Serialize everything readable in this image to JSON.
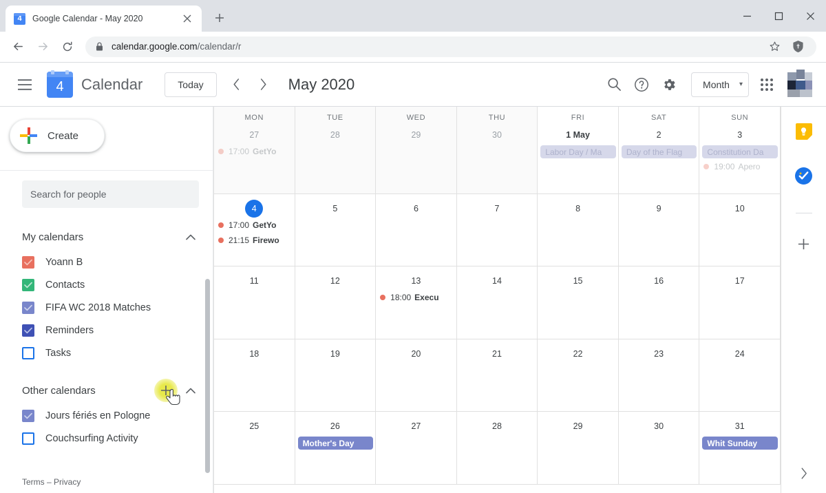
{
  "browser": {
    "tab": {
      "title": "Google Calendar - May 2020",
      "favicon_label": "4",
      "close_icon": "close-icon"
    },
    "newtab_icon": "plus-icon",
    "window_controls": {
      "minimize": "minimize-icon",
      "maximize": "maximize-icon",
      "close": "close-icon"
    },
    "nav": {
      "back": "back-arrow-icon",
      "forward": "forward-arrow-icon",
      "reload": "reload-icon"
    },
    "omnibox": {
      "lock_icon": "lock-icon",
      "url_bold": "calendar.google.com",
      "url_dim": "/calendar/r",
      "star_icon": "star-icon",
      "extension_icon": "shield-extension-icon"
    }
  },
  "app": {
    "menu_icon": "hamburger-menu-icon",
    "logo_day": "4",
    "logo_text": "Calendar",
    "today_label": "Today",
    "prev_icon": "chevron-left-icon",
    "next_icon": "chevron-right-icon",
    "month_title": "May 2020",
    "search_icon": "search-icon",
    "help_icon": "help-icon",
    "settings_icon": "gear-icon",
    "view": "Month",
    "view_caret": "chevron-down-icon",
    "apps_icon": "google-apps-grid-icon"
  },
  "sidebar": {
    "create_label": "Create",
    "search_placeholder": "Search for people",
    "search_value": "",
    "my_calendars": {
      "title": "My calendars",
      "collapse_icon": "chevron-up-icon",
      "items": [
        {
          "label": "Yoann B",
          "color": "#e8705f",
          "checked": true
        },
        {
          "label": "Contacts",
          "color": "#33b679",
          "checked": true
        },
        {
          "label": "FIFA WC 2018 Matches",
          "color": "#7986cb",
          "checked": true
        },
        {
          "label": "Reminders",
          "color": "#3f51b5",
          "checked": true
        },
        {
          "label": "Tasks",
          "color": "#1a73e8",
          "checked": false
        }
      ]
    },
    "other_calendars": {
      "title": "Other calendars",
      "add_icon": "plus-icon",
      "collapse_icon": "chevron-up-icon",
      "items": [
        {
          "label": "Jours fériés en Pologne",
          "color": "#7986cb",
          "checked": true
        },
        {
          "label": "Couchsurfing Activity",
          "color": "#1a73e8",
          "checked": false
        }
      ]
    },
    "terms": "Terms – Privacy"
  },
  "calendar": {
    "day_headers": [
      "MON",
      "TUE",
      "WED",
      "THU",
      "FRI",
      "SAT",
      "SUN"
    ],
    "weeks": [
      [
        {
          "num": "27",
          "other_month": true,
          "show_dow": true,
          "events": [
            {
              "kind": "dot",
              "time": "17:00",
              "title": "GetYo",
              "color": "#e8705f",
              "muted": true
            }
          ]
        },
        {
          "num": "28",
          "other_month": true,
          "show_dow": true,
          "events": []
        },
        {
          "num": "29",
          "other_month": true,
          "show_dow": true,
          "events": []
        },
        {
          "num": "30",
          "other_month": true,
          "show_dow": true,
          "events": []
        },
        {
          "num": "1 May",
          "first": true,
          "show_dow": true,
          "events": [
            {
              "kind": "chip",
              "title": "Labor Day / Ma",
              "muted": true
            }
          ]
        },
        {
          "num": "2",
          "show_dow": true,
          "events": [
            {
              "kind": "chip",
              "title": "Day of the Flag",
              "muted": true
            }
          ]
        },
        {
          "num": "3",
          "show_dow": true,
          "events": [
            {
              "kind": "chip",
              "title": "Constitution Da",
              "muted": true
            },
            {
              "kind": "dot",
              "time": "19:00",
              "title": "Apero",
              "color": "#e8705f",
              "muted": true
            }
          ]
        }
      ],
      [
        {
          "num": "4",
          "today": true,
          "events": [
            {
              "kind": "dot",
              "time": "17:00",
              "title": "GetYo",
              "color": "#e8705f"
            },
            {
              "kind": "dot",
              "time": "21:15",
              "title": "Firewo",
              "color": "#e8705f"
            }
          ]
        },
        {
          "num": "5",
          "events": []
        },
        {
          "num": "6",
          "events": []
        },
        {
          "num": "7",
          "events": []
        },
        {
          "num": "8",
          "events": []
        },
        {
          "num": "9",
          "events": []
        },
        {
          "num": "10",
          "events": []
        }
      ],
      [
        {
          "num": "11",
          "events": []
        },
        {
          "num": "12",
          "events": []
        },
        {
          "num": "13",
          "events": [
            {
              "kind": "dot",
              "time": "18:00",
              "title": "Execu",
              "color": "#e8705f"
            }
          ]
        },
        {
          "num": "14",
          "events": []
        },
        {
          "num": "15",
          "events": []
        },
        {
          "num": "16",
          "events": []
        },
        {
          "num": "17",
          "events": []
        }
      ],
      [
        {
          "num": "18",
          "events": []
        },
        {
          "num": "19",
          "events": []
        },
        {
          "num": "20",
          "events": []
        },
        {
          "num": "21",
          "events": []
        },
        {
          "num": "22",
          "events": []
        },
        {
          "num": "23",
          "events": []
        },
        {
          "num": "24",
          "events": []
        }
      ],
      [
        {
          "num": "25",
          "events": []
        },
        {
          "num": "26",
          "events": [
            {
              "kind": "chip",
              "title": "Mother's Day"
            }
          ]
        },
        {
          "num": "27",
          "events": []
        },
        {
          "num": "28",
          "events": []
        },
        {
          "num": "29",
          "events": []
        },
        {
          "num": "30",
          "events": []
        },
        {
          "num": "31",
          "events": [
            {
              "kind": "chip",
              "title": "Whit Sunday"
            }
          ]
        }
      ]
    ]
  },
  "rail": {
    "keep_icon": "google-keep-icon",
    "tasks_icon": "google-tasks-icon",
    "add_icon": "plus-icon",
    "expand_icon": "chevron-right-icon"
  },
  "colors": {
    "accent_blue": "#1a73e8",
    "holiday_chip": "#7986cb",
    "event_red": "#e8705f",
    "grid_line": "#e0e0e0"
  }
}
